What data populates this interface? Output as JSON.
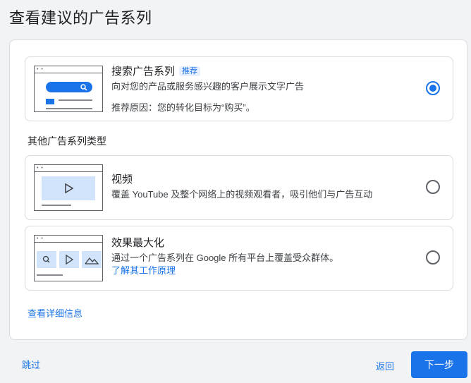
{
  "page": {
    "title": "查看建议的广告系列"
  },
  "recommended": {
    "title": "搜索广告系列",
    "badge": "推荐",
    "description": "向对您的产品或服务感兴趣的客户展示文字广告",
    "reason": "推荐原因：您的转化目标为“购买”。",
    "selected": true
  },
  "other_section": {
    "label": "其他广告系列类型"
  },
  "video": {
    "title": "视频",
    "description": "覆盖 YouTube 及整个网络上的视频观看者，吸引他们与广告互动",
    "selected": false
  },
  "pmax": {
    "title": "效果最大化",
    "description": "通过一个广告系列在 Google 所有平台上覆盖受众群体。",
    "link": "了解其工作原理",
    "selected": false
  },
  "details_link": "查看详细信息",
  "footer": {
    "skip": "跳过",
    "back": "返回",
    "next": "下一步"
  },
  "colors": {
    "accent": "#1a73e8",
    "illustration_fill": "#d2e3fc",
    "border": "#dadce0"
  }
}
